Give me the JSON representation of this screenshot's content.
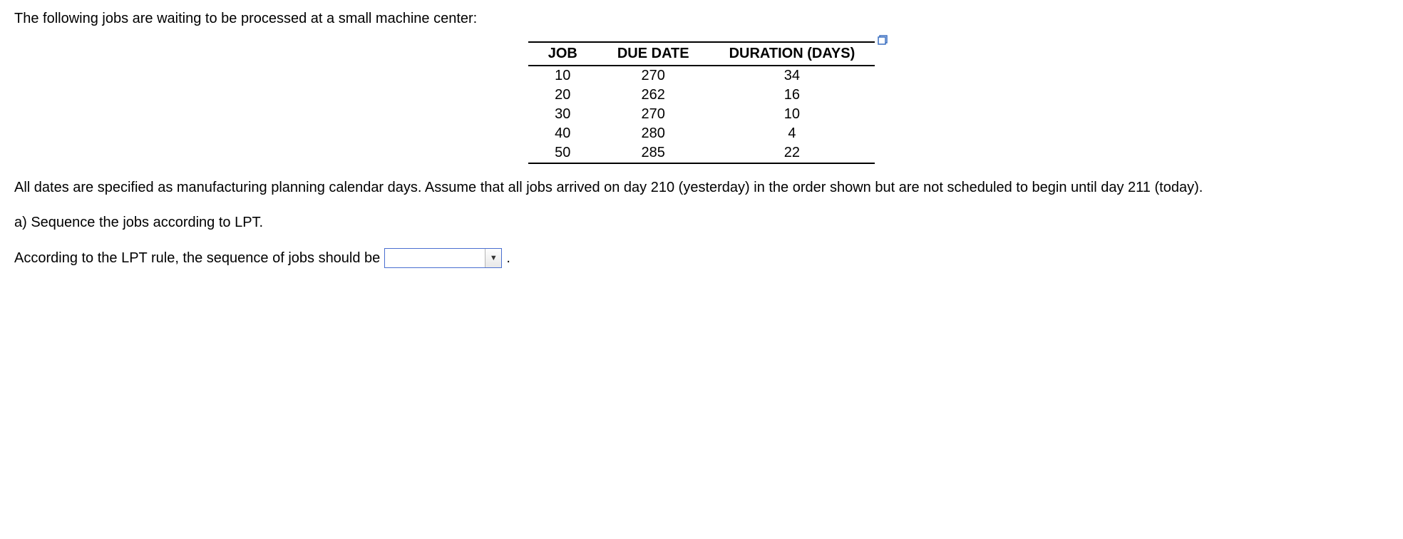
{
  "intro": "The following jobs are waiting to be processed at a small machine center:",
  "table": {
    "headers": {
      "c0": "JOB",
      "c1": "DUE DATE",
      "c2": "DURATION (DAYS)"
    },
    "rows": [
      {
        "c0": "10",
        "c1": "270",
        "c2": "34"
      },
      {
        "c0": "20",
        "c1": "262",
        "c2": "16"
      },
      {
        "c0": "30",
        "c1": "270",
        "c2": "10"
      },
      {
        "c0": "40",
        "c1": "280",
        "c2": "4"
      },
      {
        "c0": "50",
        "c1": "285",
        "c2": "22"
      }
    ]
  },
  "chart_data": {
    "type": "table",
    "title": "Jobs waiting at machine center",
    "columns": [
      "JOB",
      "DUE DATE",
      "DURATION (DAYS)"
    ],
    "rows": [
      [
        10,
        270,
        34
      ],
      [
        20,
        262,
        16
      ],
      [
        30,
        270,
        10
      ],
      [
        40,
        280,
        4
      ],
      [
        50,
        285,
        22
      ]
    ]
  },
  "body_text": "All dates are specified as manufacturing planning calendar days. Assume that all jobs arrived on day 210 (yesterday) in the order shown but are not scheduled to begin until day 211 (today).",
  "part_a": "a) Sequence the jobs according to LPT.",
  "answer_prefix": "According to the LPT rule, the sequence of jobs should be",
  "dropdown": {
    "value": "",
    "arrow": "▼"
  },
  "period": "."
}
